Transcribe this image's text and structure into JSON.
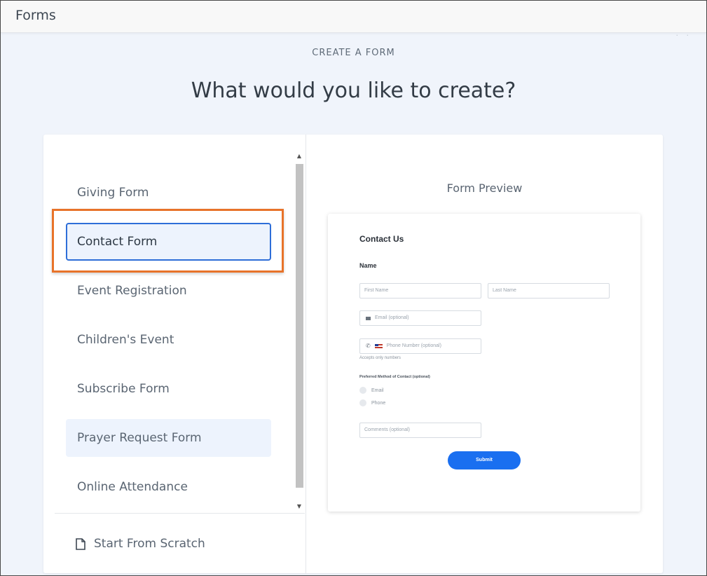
{
  "app": {
    "title": "Forms"
  },
  "header": {
    "eyebrow": "CREATE A FORM",
    "headline": "What would you like to create?"
  },
  "form_types": [
    {
      "label": "Giving Form",
      "state": "default"
    },
    {
      "label": "Contact Form",
      "state": "selected"
    },
    {
      "label": "Event Registration",
      "state": "default"
    },
    {
      "label": "Children's Event",
      "state": "default"
    },
    {
      "label": "Subscribe Form",
      "state": "default"
    },
    {
      "label": "Prayer Request Form",
      "state": "hover"
    },
    {
      "label": "Online Attendance",
      "state": "default"
    }
  ],
  "scratch": {
    "label": "Start From Scratch",
    "icon": "document-icon"
  },
  "preview": {
    "heading": "Form Preview",
    "form_title": "Contact Us",
    "name_label": "Name",
    "first_name_placeholder": "First Name",
    "last_name_placeholder": "Last Name",
    "email_placeholder": "Email  (optional)",
    "phone_placeholder": "Phone Number  (optional)",
    "phone_hint": "Accepts only numbers",
    "preferred_label": "Preferred Method of Contact  (optional)",
    "options": [
      "Email",
      "Phone"
    ],
    "comments_placeholder": "Comments  (optional)",
    "submit_label": "Submit"
  },
  "colors": {
    "accent": "#2e6ed8",
    "annotation": "#e8732a",
    "submit": "#1a6ff0"
  }
}
